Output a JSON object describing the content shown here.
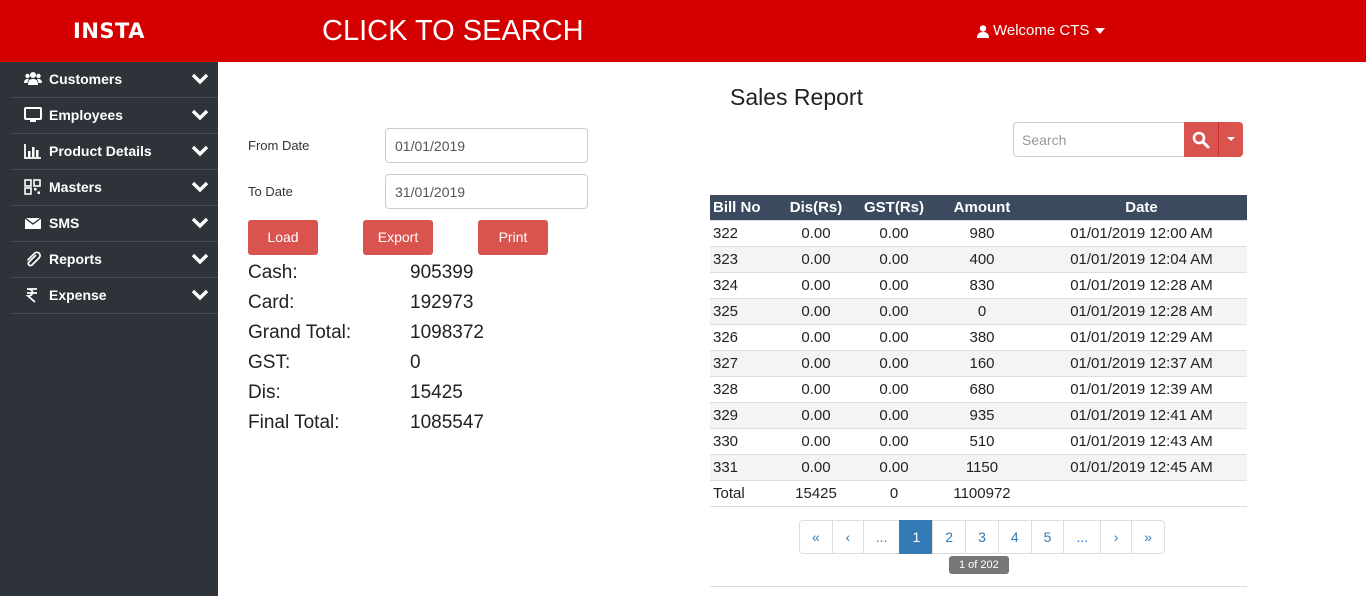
{
  "header": {
    "brand": "INSTA",
    "search_banner": "CLICK TO SEARCH",
    "welcome": "Welcome CTS"
  },
  "sidebar": {
    "items": [
      {
        "label": "Customers",
        "icon": "users-icon"
      },
      {
        "label": "Employees",
        "icon": "monitor-icon"
      },
      {
        "label": "Product Details",
        "icon": "bar-chart-icon"
      },
      {
        "label": "Masters",
        "icon": "qrcode-icon"
      },
      {
        "label": "SMS",
        "icon": "envelope-icon"
      },
      {
        "label": "Reports",
        "icon": "paperclip-icon"
      },
      {
        "label": "Expense",
        "icon": "rupee-icon"
      }
    ]
  },
  "filters": {
    "from_label": "From Date",
    "from_value": "01/01/2019",
    "to_label": "To Date",
    "to_value": "31/01/2019",
    "load_label": "Load",
    "export_label": "Export",
    "print_label": "Print"
  },
  "summary": [
    {
      "label": "Cash:",
      "value": "905399"
    },
    {
      "label": "Card:",
      "value": "192973"
    },
    {
      "label": "Grand Total:",
      "value": "1098372"
    },
    {
      "label": "GST:",
      "value": "0"
    },
    {
      "label": "Dis:",
      "value": "15425"
    },
    {
      "label": "Final Total:",
      "value": "1085547"
    }
  ],
  "report": {
    "title": "Sales Report",
    "search_placeholder": "Search",
    "columns": [
      "Bill No",
      "Dis(Rs)",
      "GST(Rs)",
      "Amount",
      "Date"
    ],
    "rows": [
      [
        "322",
        "0.00",
        "0.00",
        "980",
        "01/01/2019 12:00 AM"
      ],
      [
        "323",
        "0.00",
        "0.00",
        "400",
        "01/01/2019 12:04 AM"
      ],
      [
        "324",
        "0.00",
        "0.00",
        "830",
        "01/01/2019 12:28 AM"
      ],
      [
        "325",
        "0.00",
        "0.00",
        "0",
        "01/01/2019 12:28 AM"
      ],
      [
        "326",
        "0.00",
        "0.00",
        "380",
        "01/01/2019 12:29 AM"
      ],
      [
        "327",
        "0.00",
        "0.00",
        "160",
        "01/01/2019 12:37 AM"
      ],
      [
        "328",
        "0.00",
        "0.00",
        "680",
        "01/01/2019 12:39 AM"
      ],
      [
        "329",
        "0.00",
        "0.00",
        "935",
        "01/01/2019 12:41 AM"
      ],
      [
        "330",
        "0.00",
        "0.00",
        "510",
        "01/01/2019 12:43 AM"
      ],
      [
        "331",
        "0.00",
        "0.00",
        "1150",
        "01/01/2019 12:45 AM"
      ]
    ],
    "totals": [
      "Total",
      "15425",
      "0",
      "1100972",
      ""
    ]
  },
  "pagination": {
    "pages": [
      "«",
      "‹",
      "...",
      "1",
      "2",
      "3",
      "4",
      "5",
      "...",
      "›",
      "»"
    ],
    "active": "1",
    "info": "1 of 202"
  },
  "colors": {
    "header_bg": "#d40000",
    "sidebar_bg": "#2d3338",
    "button_bg": "#d9534f",
    "table_header_bg": "#3b4a5e",
    "pager_active": "#337ab7"
  }
}
